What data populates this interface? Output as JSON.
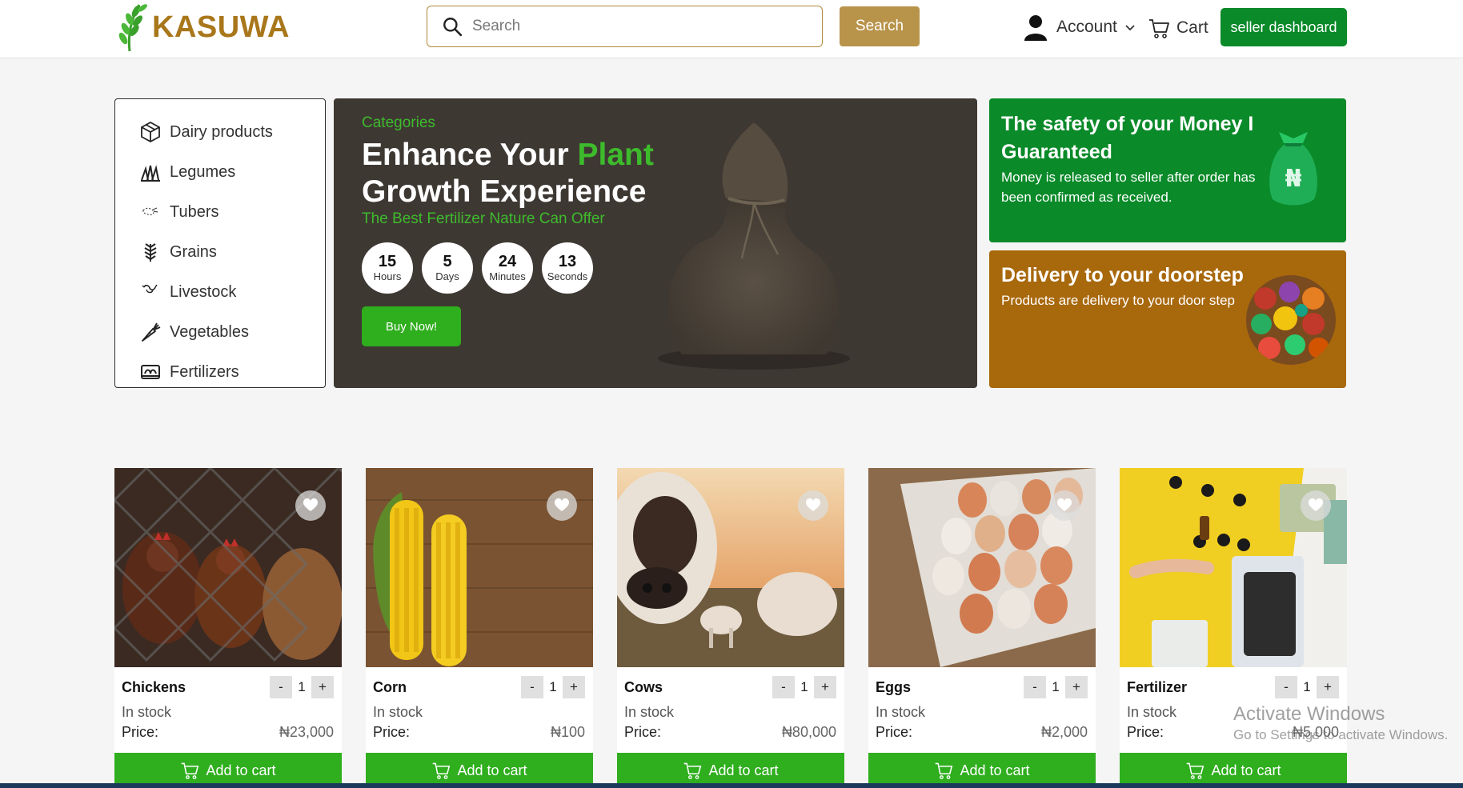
{
  "brand": {
    "name": "KASUWA"
  },
  "search": {
    "placeholder": "Search",
    "value": "",
    "button_label": "Search"
  },
  "nav": {
    "account_label": "Account",
    "cart_label": "Cart",
    "seller_label": "seller dashboard"
  },
  "categories": [
    {
      "label": "Dairy products",
      "icon": "box-icon"
    },
    {
      "label": "Legumes",
      "icon": "legume-icon"
    },
    {
      "label": "Tubers",
      "icon": "tuber-icon"
    },
    {
      "label": "Grains",
      "icon": "grain-icon"
    },
    {
      "label": "Livestock",
      "icon": "livestock-icon"
    },
    {
      "label": "Vegetables",
      "icon": "carrot-icon"
    },
    {
      "label": "Fertilizers",
      "icon": "fertilizer-icon"
    }
  ],
  "hero": {
    "category_label": "Categories",
    "title_part1": "Enhance Your ",
    "title_highlight": "Plant",
    "title_part2": "Growth Experience",
    "subtitle": "The Best Fertilizer Nature Can Offer",
    "countdown": [
      {
        "value": "15",
        "unit": "Hours"
      },
      {
        "value": "5",
        "unit": "Days"
      },
      {
        "value": "24",
        "unit": "Minutes"
      },
      {
        "value": "13",
        "unit": "Seconds"
      }
    ],
    "buy_label": "Buy Now!"
  },
  "promos": {
    "money": {
      "title": "The safety of your Money I Guaranteed",
      "text": "Money is released to seller after order has been confirmed as received.",
      "symbol": "₦"
    },
    "delivery": {
      "title": "Delivery to your doorstep",
      "text": "Products are delivery to your door step"
    }
  },
  "products": [
    {
      "name": "Chickens",
      "qty": "1",
      "stock": "In stock",
      "price_label": "Price:",
      "price": "₦23,000",
      "add_label": "Add to cart"
    },
    {
      "name": "Corn",
      "qty": "1",
      "stock": "In stock",
      "price_label": "Price:",
      "price": "₦100",
      "add_label": "Add to cart"
    },
    {
      "name": "Cows",
      "qty": "1",
      "stock": "In stock",
      "price_label": "Price:",
      "price": "₦80,000",
      "add_label": "Add to cart"
    },
    {
      "name": "Eggs",
      "qty": "1",
      "stock": "In stock",
      "price_label": "Price:",
      "price": "₦2,000",
      "add_label": "Add to cart"
    },
    {
      "name": "Fertilizer",
      "qty": "1",
      "stock": "In stock",
      "price_label": "Price:",
      "price": "₦5,000",
      "add_label": "Add to cart"
    }
  ],
  "qty_controls": {
    "minus": "-",
    "plus": "+"
  },
  "watermark": {
    "line1": "Activate Windows",
    "line2": "Go to Settings to activate Windows."
  },
  "colors": {
    "brand_gold": "#a9771b",
    "primary_green": "#0a8a29",
    "button_green": "#2fae1e",
    "search_button": "#b8934a",
    "hero_bg": "#3e3833",
    "delivery_bg": "#a8680c"
  }
}
